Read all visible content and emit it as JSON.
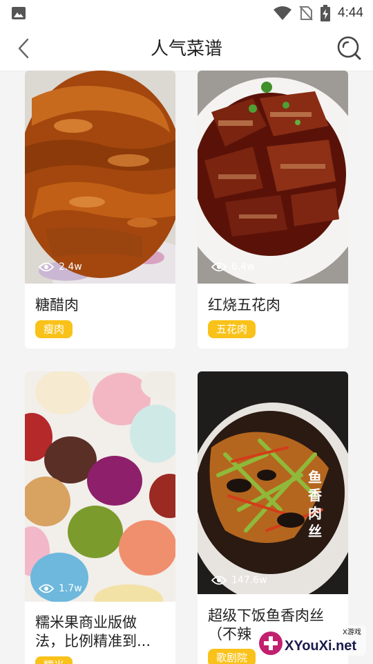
{
  "status_bar": {
    "time": "4:44"
  },
  "header": {
    "title": "人气菜谱"
  },
  "recipes": [
    {
      "name": "糖醋肉",
      "tag": "瘦肉",
      "views": "2.4w"
    },
    {
      "name": "红烧五花肉",
      "tag": "五花肉",
      "views": "6.4w"
    },
    {
      "name": "糯米果商业版做法，比例精准到...",
      "name_line1": "糯米果商业版做",
      "name_line2": "法，比例精准到...",
      "tag": "糯米",
      "views": "1.7w"
    },
    {
      "name": "超级下饭鱼香肉丝（不辣版）",
      "name_line1": "超级下饭鱼香肉丝",
      "name_line2": "（不辣",
      "tag": "歌剧院",
      "views": "147.6w",
      "image_caption": "鱼香肉丝"
    }
  ],
  "watermark": {
    "brand": "XYouXi.net",
    "label": "X游戏"
  },
  "colors": {
    "accent": "#f9c21a",
    "background": "#f4f4f4",
    "card": "#ffffff"
  },
  "icons": [
    "image-icon",
    "wifi-icon",
    "no-sim-icon",
    "battery-charging-icon",
    "back-arrow-icon",
    "search-icon",
    "eye-icon"
  ]
}
